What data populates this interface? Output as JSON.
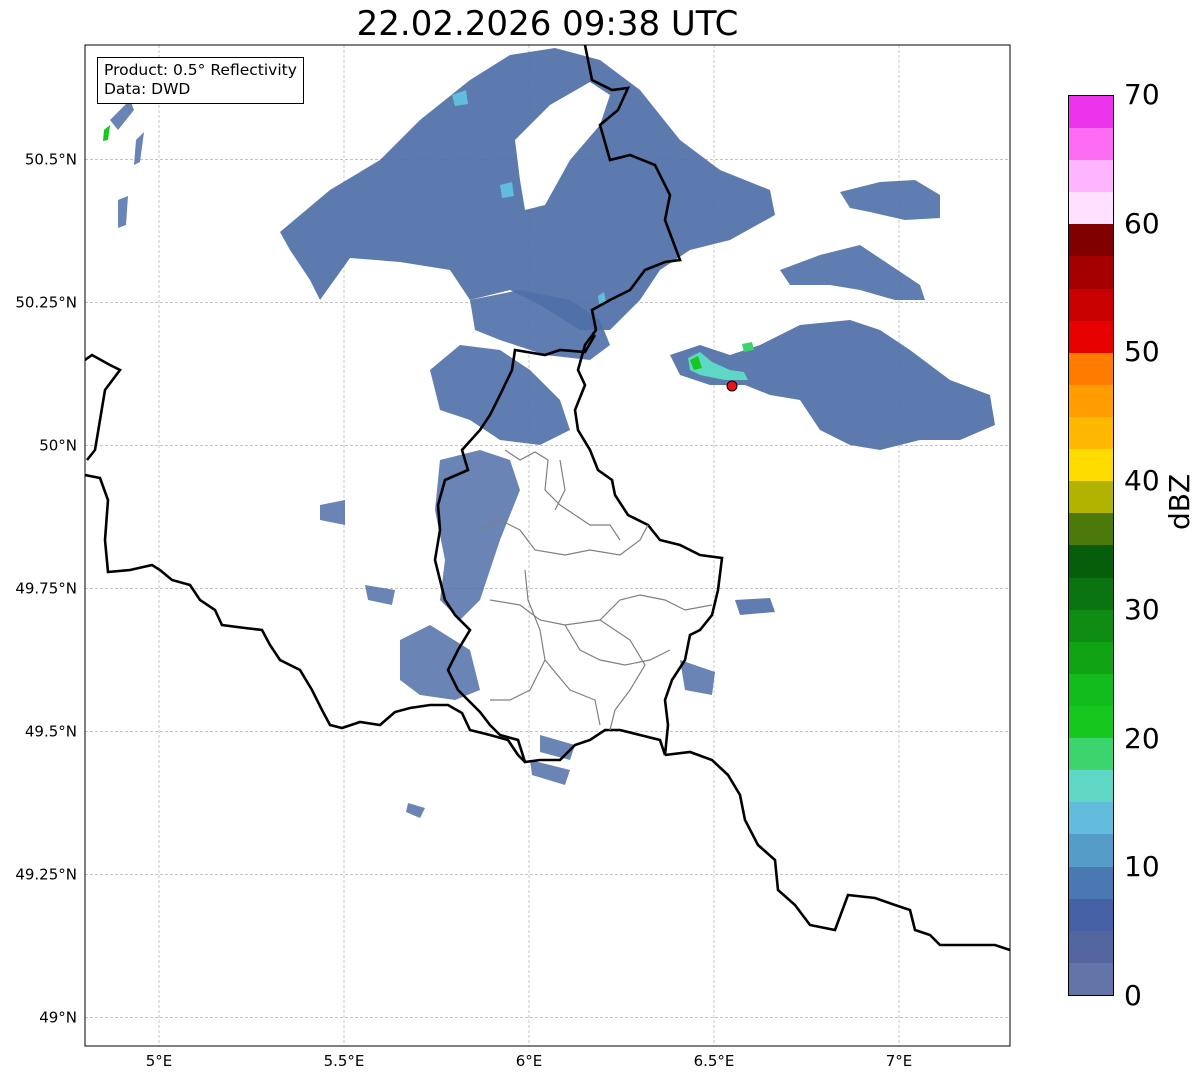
{
  "title": "22.02.2026 09:38 UTC",
  "info": {
    "product": "Product: 0.5° Reflectivity",
    "data": "Data: DWD"
  },
  "map": {
    "lon_range": [
      4.8,
      7.3
    ],
    "lat_range": [
      48.95,
      50.7
    ],
    "lon_ticks": [
      "5°E",
      "5.5°E",
      "6°E",
      "6.5°E",
      "7°E"
    ],
    "lat_ticks": [
      "49°N",
      "49.25°N",
      "49.5°N",
      "49.75°N",
      "50°N",
      "50.25°N",
      "50.5°N"
    ],
    "grid": true,
    "radar_site_color": "#e8141c",
    "border_color": "#000000",
    "admin_border_color": "#808080"
  },
  "colorbar": {
    "label": "dBZ",
    "ticks": [
      "0",
      "10",
      "20",
      "30",
      "40",
      "50",
      "60",
      "70"
    ],
    "min": 0,
    "max": 70,
    "step": 2.5,
    "colors": [
      "#6274a8",
      "#5366a0",
      "#4560a4",
      "#4a78b2",
      "#569cc8",
      "#62bcdc",
      "#5ed8c4",
      "#3cd46c",
      "#16c81e",
      "#12bc1c",
      "#10a414",
      "#0e8c14",
      "#0a7410",
      "#075e0a",
      "#4c7a0a",
      "#b0b400",
      "#ffdc00",
      "#ffb800",
      "#ff9c00",
      "#ff7c00",
      "#e60000",
      "#c80000",
      "#a40000",
      "#800000",
      "#ffe0ff",
      "#ffb4ff",
      "#ff6cf4",
      "#ec34ec"
    ]
  }
}
